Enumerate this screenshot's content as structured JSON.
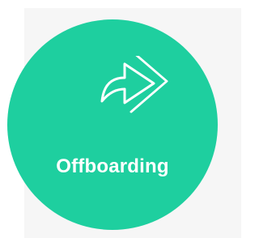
{
  "tile": {
    "label": "Offboarding",
    "icon": "double-forward-arrow-icon",
    "colors": {
      "accent": "#1ecf9f",
      "text": "#ffffff",
      "panel_background": "#f6f6f6",
      "page_background": "#ffffff"
    }
  }
}
